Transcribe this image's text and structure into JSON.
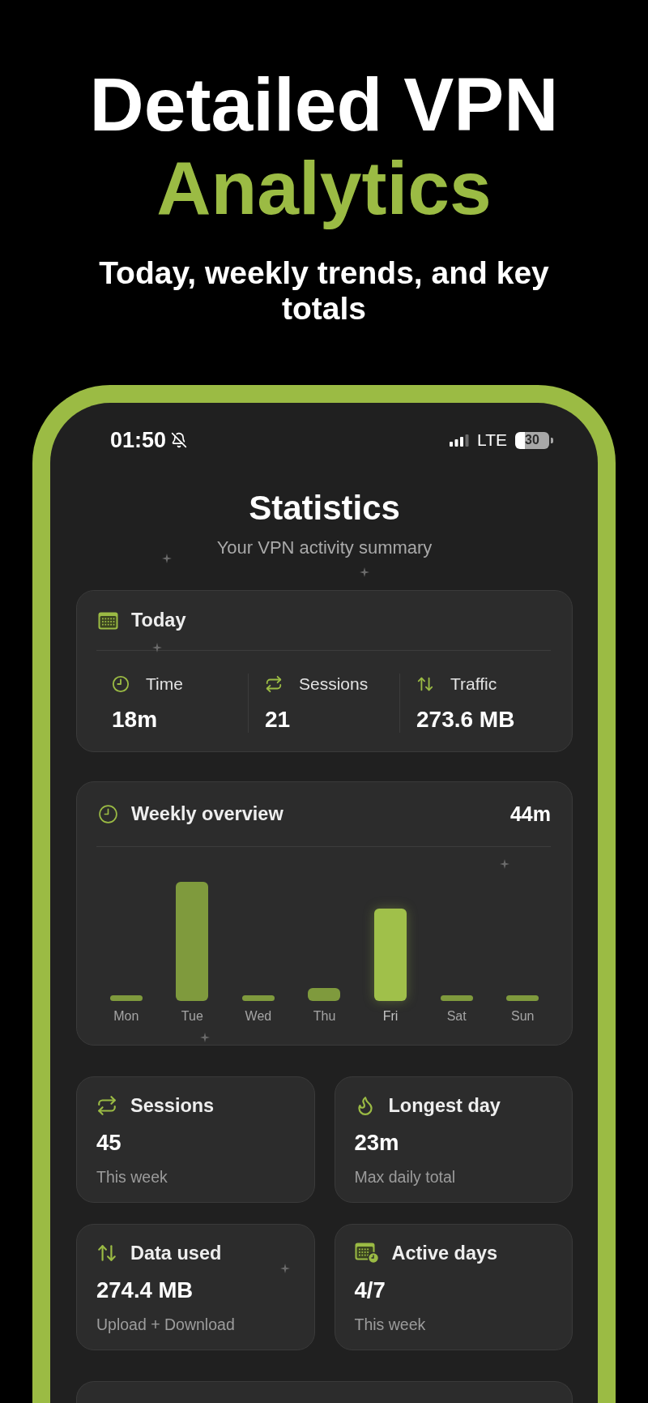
{
  "headline": {
    "title": "Detailed VPN",
    "highlight": "Analytics"
  },
  "tagline": "Today, weekly trends, and key totals",
  "status_bar": {
    "time": "01:50",
    "network": "LTE",
    "battery": "30"
  },
  "header": {
    "title": "Statistics",
    "subtitle": "Your VPN activity summary"
  },
  "today": {
    "title": "Today",
    "metrics": [
      {
        "label": "Time",
        "value": "18m"
      },
      {
        "label": "Sessions",
        "value": "21"
      },
      {
        "label": "Traffic",
        "value": "273.6 MB"
      }
    ]
  },
  "weekly": {
    "title": "Weekly overview",
    "total": "44m",
    "days": [
      {
        "label": "Mon",
        "selected": false
      },
      {
        "label": "Tue",
        "selected": false
      },
      {
        "label": "Wed",
        "selected": false
      },
      {
        "label": "Thu",
        "selected": false
      },
      {
        "label": "Fri",
        "selected": true
      },
      {
        "label": "Sat",
        "selected": false
      },
      {
        "label": "Sun",
        "selected": false
      }
    ]
  },
  "stats": [
    {
      "title": "Sessions",
      "value": "45",
      "caption": "This week"
    },
    {
      "title": "Longest day",
      "value": "23m",
      "caption": "Max daily total"
    },
    {
      "title": "Data used",
      "value": "274.4 MB",
      "caption": "Upload + Download"
    },
    {
      "title": "Active days",
      "value": "4/7",
      "caption": "This week"
    }
  ]
}
